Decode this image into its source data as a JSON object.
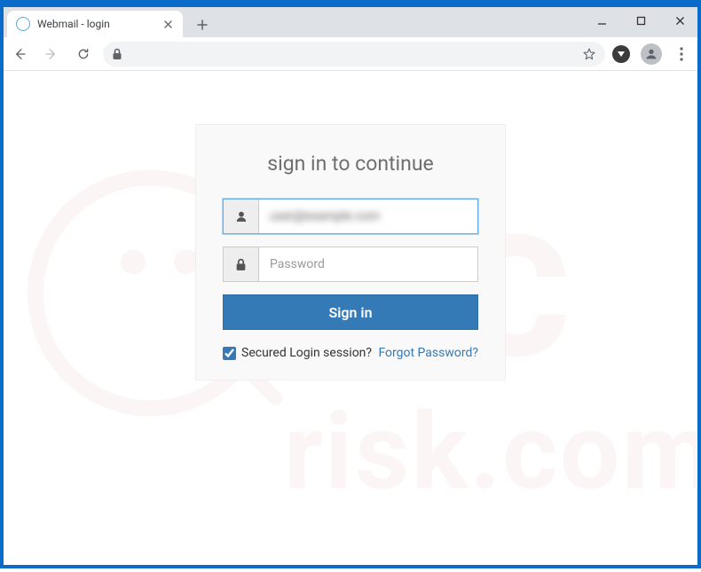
{
  "browser": {
    "tab": {
      "title": "Webmail - login"
    },
    "address": "",
    "window_controls": {
      "min": "−",
      "max": "☐",
      "close": "✕"
    }
  },
  "login": {
    "heading": "sign in to continue",
    "username_value": "user@example.com",
    "password_placeholder": "Password",
    "password_value": "",
    "submit_label": "Sign in",
    "secured_label": "Secured Login session?",
    "secured_checked": true,
    "forgot_label": "Forgot Password?"
  }
}
